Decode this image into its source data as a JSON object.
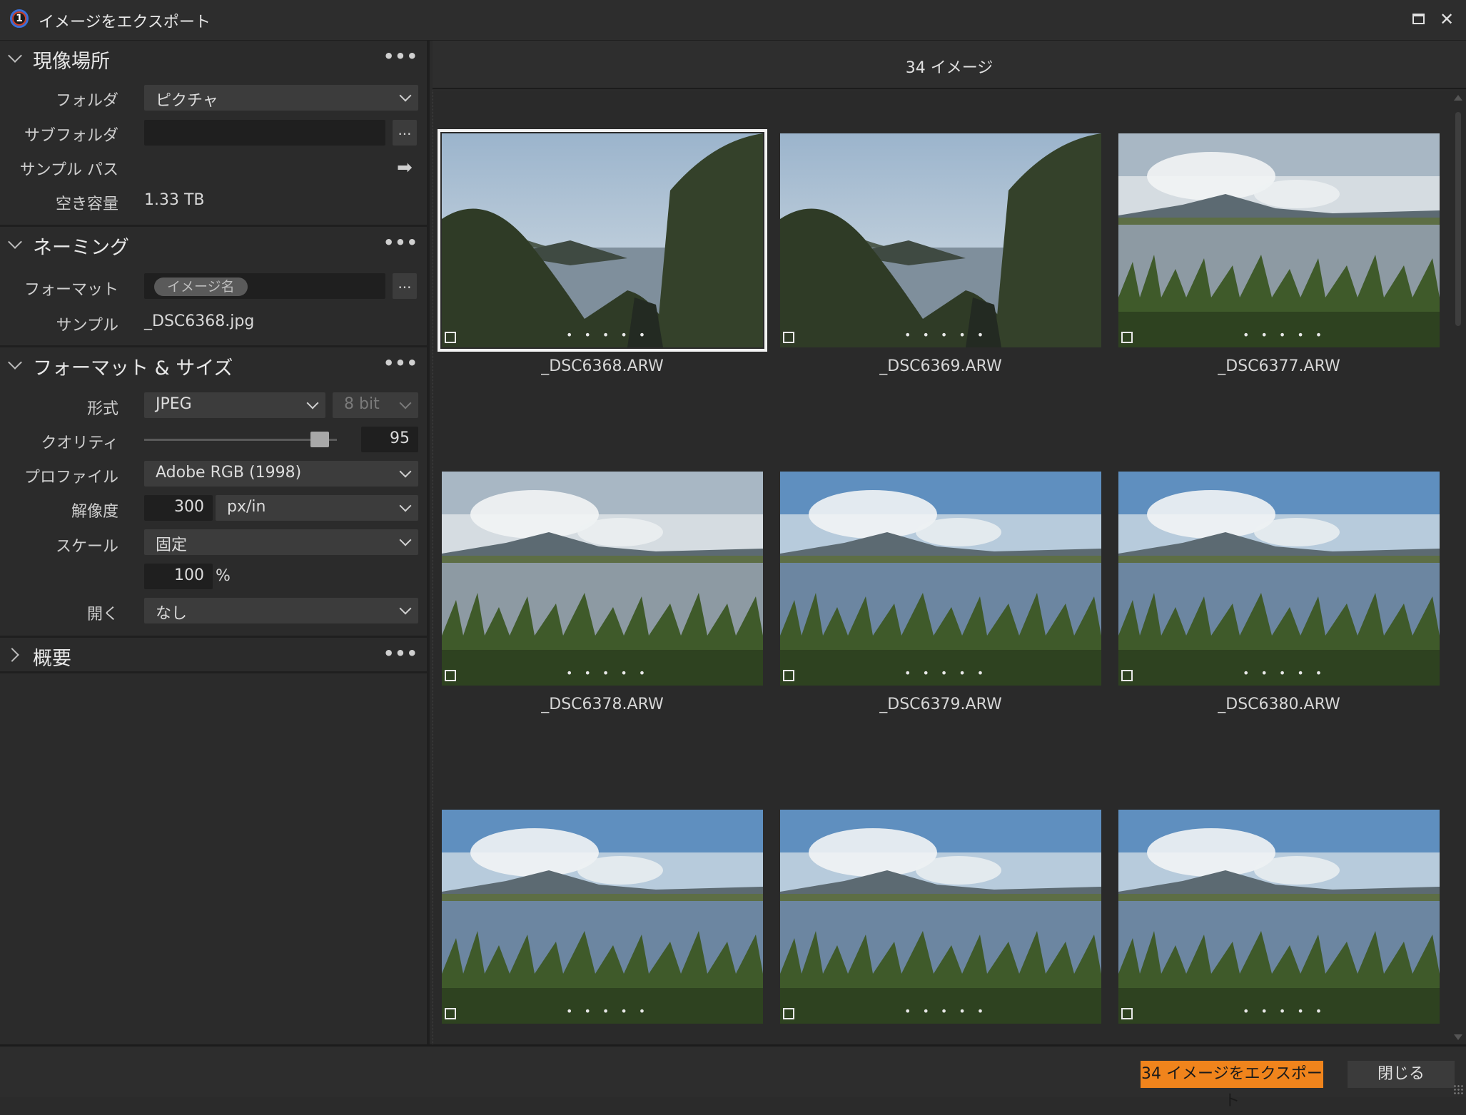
{
  "window": {
    "title": "イメージをエクスポート"
  },
  "sections": {
    "location": {
      "title": "現像場所",
      "folder_label": "フォルダ",
      "folder_value": "ピクチャ",
      "subfolder_label": "サブフォルダ",
      "subfolder_value": "",
      "browse_label": "...",
      "sample_path_label": "サンプル パス",
      "free_space_label": "空き容量",
      "free_space_value": "1.33 TB"
    },
    "naming": {
      "title": "ネーミング",
      "format_label": "フォーマット",
      "format_token": "イメージ名",
      "browse_label": "...",
      "sample_label": "サンプル",
      "sample_value": "_DSC6368.jpg"
    },
    "format_size": {
      "title": "フォーマット & サイズ",
      "type_label": "形式",
      "type_value": "JPEG",
      "bit_value": "8 bit",
      "quality_label": "クオリティ",
      "quality_value": "95",
      "profile_label": "プロファイル",
      "profile_value": "Adobe RGB (1998)",
      "resolution_label": "解像度",
      "resolution_value": "300",
      "resolution_unit": "px/in",
      "scale_label": "スケール",
      "scale_value": "固定",
      "scale_percent": "100",
      "percent_sign": "%",
      "open_label": "開く",
      "open_value": "なし"
    },
    "summary": {
      "title": "概要"
    }
  },
  "grid": {
    "count_label": "34 イメージ",
    "images": [
      {
        "name": "_DSC6368.ARW",
        "scene": "coast",
        "selected": true
      },
      {
        "name": "_DSC6369.ARW",
        "scene": "coast",
        "selected": false
      },
      {
        "name": "_DSC6377.ARW",
        "scene": "lake-bright",
        "selected": false
      },
      {
        "name": "_DSC6378.ARW",
        "scene": "lake-bright",
        "selected": false
      },
      {
        "name": "_DSC6379.ARW",
        "scene": "lake-blue",
        "selected": false
      },
      {
        "name": "_DSC6380.ARW",
        "scene": "lake-blue",
        "selected": false
      },
      {
        "name": "",
        "scene": "lake-blue",
        "selected": false
      },
      {
        "name": "",
        "scene": "lake-blue",
        "selected": false
      },
      {
        "name": "",
        "scene": "lake-blue",
        "selected": false
      }
    ]
  },
  "footer": {
    "export_label": "34 イメージをエクスポート",
    "close_label": "閉じる"
  },
  "colors": {
    "accent": "#f0841c",
    "background": "#2b2b2b"
  }
}
